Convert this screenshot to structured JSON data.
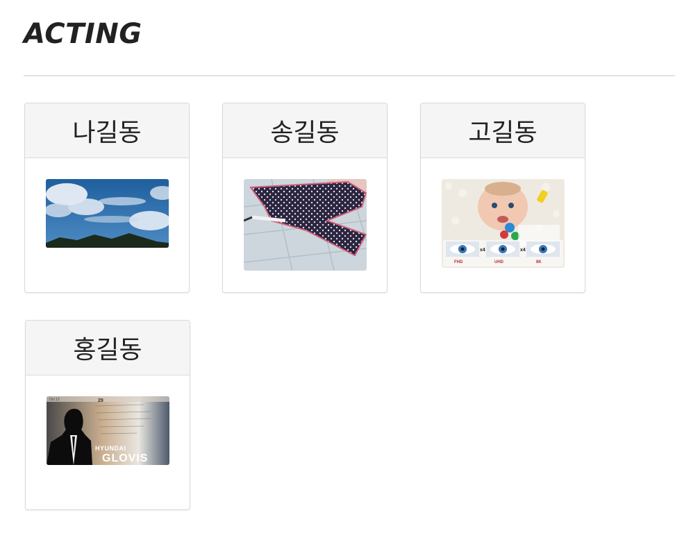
{
  "page": {
    "title": "ACTING"
  },
  "cards": [
    {
      "name": "나길동",
      "image": "sky-clouds-mountains-photo"
    },
    {
      "name": "송길동",
      "image": "polka-dot-umbrella-photo"
    },
    {
      "name": "고길동",
      "image": "baby-eyes-resolution-photo"
    },
    {
      "name": "홍길동",
      "image": "hyundai-glovis-silhouette-photo"
    }
  ],
  "thumb_text": {
    "fhd": "FHD",
    "uhd": "UHD",
    "k8": "8K",
    "x4a": "x4",
    "x4b": "x4",
    "brand_small": "HYUNDAI",
    "brand_big": "GLOVIS",
    "date_a": "29",
    "date_b": "Oct 12"
  }
}
